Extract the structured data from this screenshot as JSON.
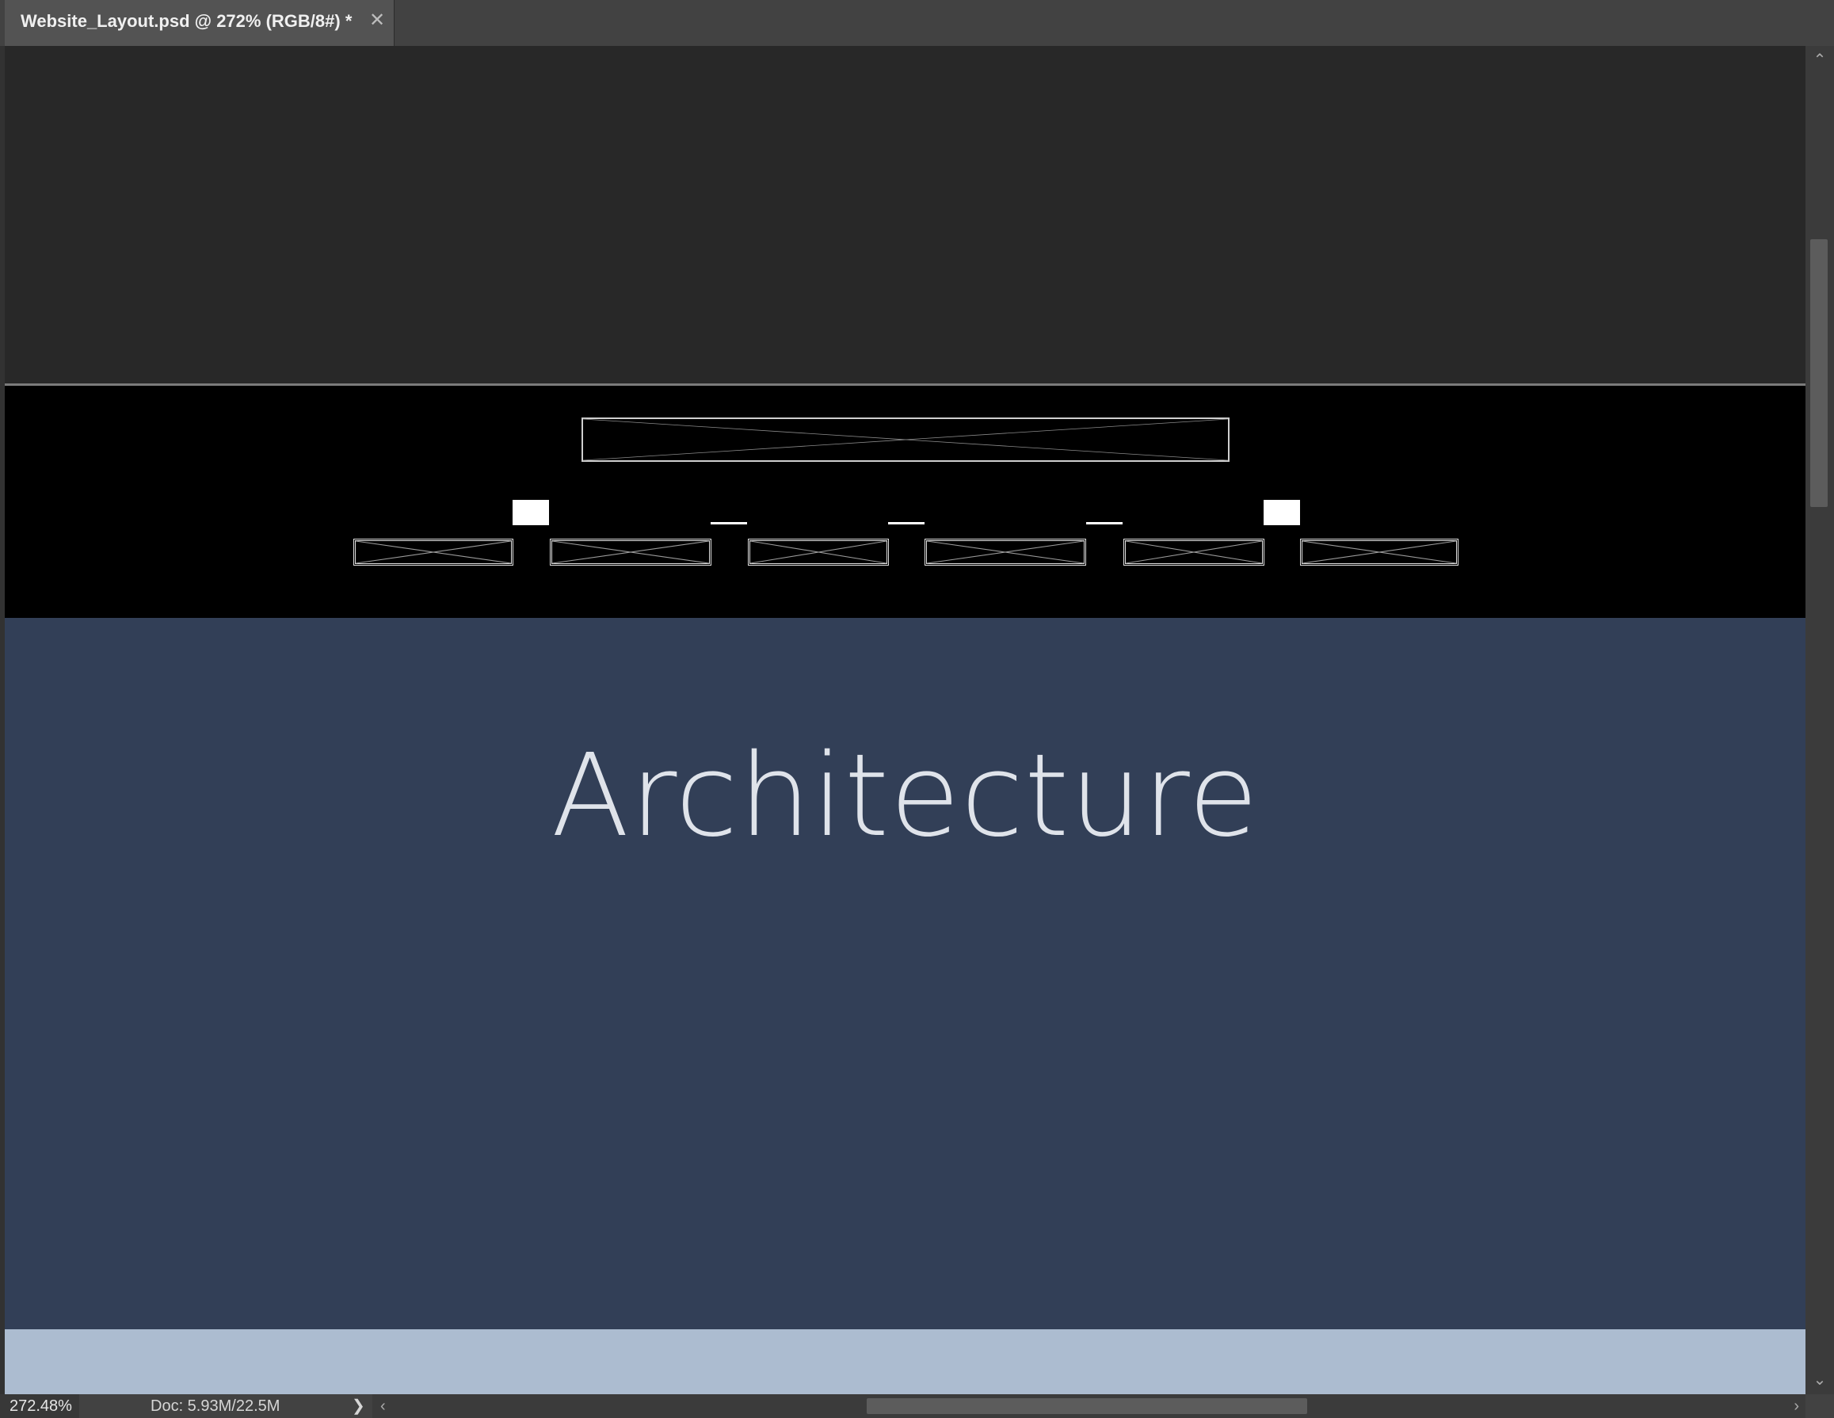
{
  "tab": {
    "title": "Website_Layout.psd @ 272% (RGB/8#) *",
    "close_icon": "close-icon"
  },
  "canvas": {
    "hero_title": "Architecture",
    "colors": {
      "pasteboard": "#282828",
      "header": "#000000",
      "hero": "#323f57",
      "band": "#acbcd0"
    }
  },
  "status": {
    "zoom": "272.48%",
    "doc": "Doc: 5.93M/22.5M",
    "arrow": "❯"
  },
  "scroll": {
    "up": "⌃",
    "down": "⌄",
    "left": "‹",
    "right": "›"
  }
}
